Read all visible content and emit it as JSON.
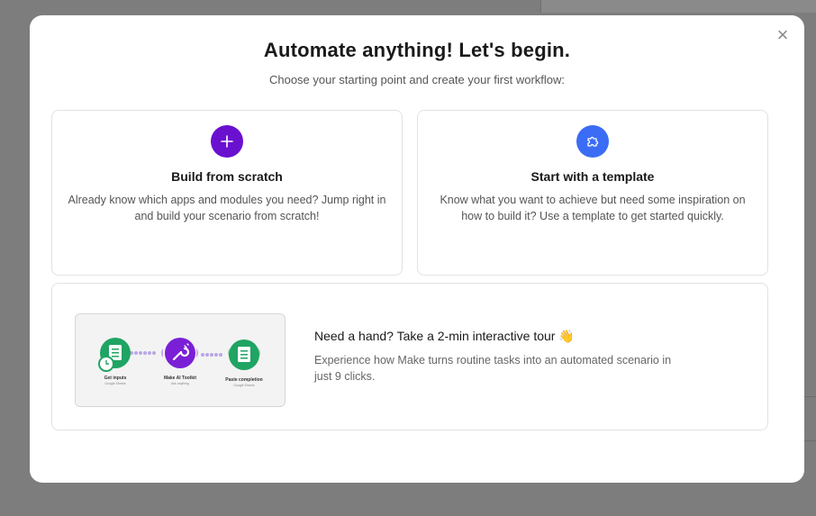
{
  "modal": {
    "title": "Automate anything! Let's begin.",
    "subtitle": "Choose your starting point and create your first workflow:",
    "close_glyph": "×"
  },
  "cards": [
    {
      "icon": "plus-icon",
      "title": "Build from scratch",
      "description": "Already know which apps and modules you need? Jump right in and build your scenario from scratch!",
      "accent": "#6a10cf"
    },
    {
      "icon": "puzzle-icon",
      "title": "Start with a template",
      "description": "Know what you want to achieve but need some inspiration on how to build it? Use a template to get started quickly.",
      "accent": "#3b6cf5"
    }
  ],
  "tour": {
    "title": "Need a hand? Take a 2-min interactive tour 👋",
    "description": "Experience how Make turns routine tasks into an automated scenario in just 9 clicks.",
    "preview": {
      "nodes": [
        {
          "label": "Get inputs",
          "sub": "Google Sheets",
          "icon": "sheets-icon"
        },
        {
          "label": "Make AI Toolkit",
          "sub": "Ask anything",
          "icon": "wrench-icon"
        },
        {
          "label": "Paste completion",
          "sub": "Google Sheets",
          "icon": "sheets-icon"
        }
      ]
    }
  }
}
